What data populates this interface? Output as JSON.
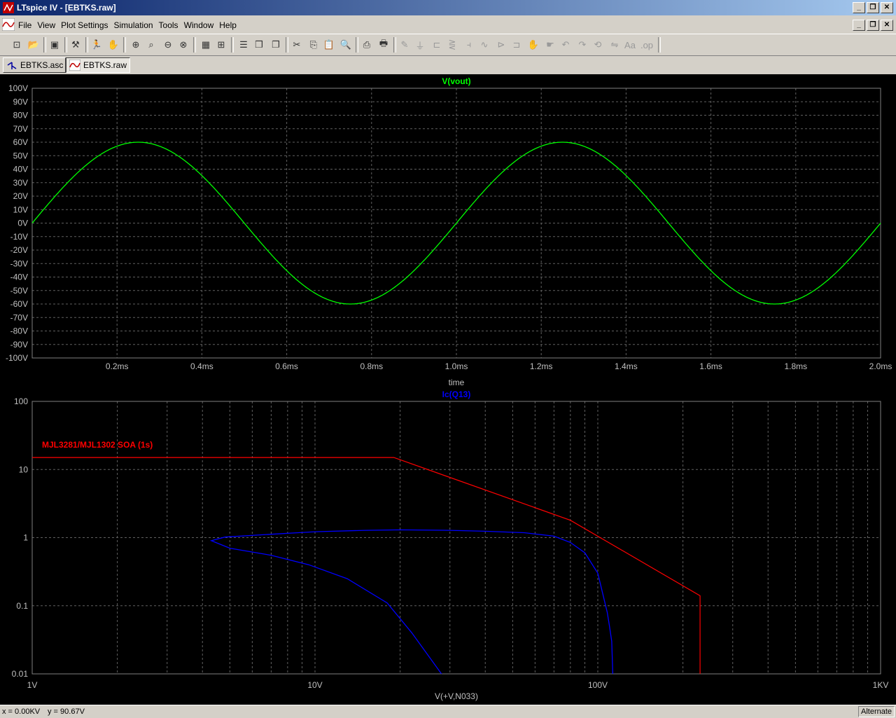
{
  "window": {
    "title": "LTspice IV - [EBTKS.raw]"
  },
  "menu": [
    "File",
    "View",
    "Plot Settings",
    "Simulation",
    "Tools",
    "Window",
    "Help"
  ],
  "tabs": [
    {
      "label": "EBTKS.asc",
      "icon": "schematic-icon"
    },
    {
      "label": "EBTKS.raw",
      "icon": "waveform-icon"
    }
  ],
  "top_plot": {
    "trace_label": "V(vout)",
    "trace_color": "#00ff00",
    "x_axis_label": "time",
    "x_ticks": [
      "0.2ms",
      "0.4ms",
      "0.6ms",
      "0.8ms",
      "1.0ms",
      "1.2ms",
      "1.4ms",
      "1.6ms",
      "1.8ms",
      "2.0ms"
    ],
    "y_ticks": [
      "100V",
      "90V",
      "80V",
      "70V",
      "60V",
      "50V",
      "40V",
      "30V",
      "20V",
      "10V",
      "0V",
      "-10V",
      "-20V",
      "-30V",
      "-40V",
      "-50V",
      "-60V",
      "-70V",
      "-80V",
      "-90V",
      "-100V"
    ]
  },
  "bottom_plot": {
    "trace_label": "Ic(Q13)",
    "trace_color": "#0000ff",
    "annotation": "MJL3281/MJL1302 SOA (1s)",
    "annotation_color": "#ff0000",
    "x_axis_label": "V(+V,N033)",
    "x_ticks": [
      "1V",
      "10V",
      "100V",
      "1KV"
    ],
    "y_ticks": [
      "100",
      "10",
      "1",
      "0.1",
      "0.01"
    ]
  },
  "status": {
    "x": "x = 0.00KV",
    "y": "y = 90.67V",
    "mode": "Alternate"
  },
  "chart_data": [
    {
      "type": "line",
      "title": "V(vout)",
      "xlabel": "time",
      "ylabel": "",
      "xlim_ms": [
        0,
        2.0
      ],
      "ylim": [
        -100,
        100
      ],
      "grid": true,
      "series": [
        {
          "name": "V(vout)",
          "color": "#00ff00",
          "x_ms": [
            0,
            0.125,
            0.25,
            0.375,
            0.5,
            0.625,
            0.75,
            0.875,
            1.0,
            1.125,
            1.25,
            1.375,
            1.5,
            1.625,
            1.75,
            1.875,
            2.0
          ],
          "y": [
            0,
            42.4,
            60,
            42.4,
            0,
            -42.4,
            -60,
            -42.4,
            0,
            42.4,
            60,
            42.4,
            0,
            -42.4,
            -60,
            -42.4,
            0
          ]
        }
      ]
    },
    {
      "type": "line",
      "title": "Ic(Q13)",
      "xlabel": "V(+V,N033)",
      "xscale": "log",
      "yscale": "log",
      "xlim": [
        1,
        1000
      ],
      "ylim": [
        0.01,
        100
      ],
      "grid": true,
      "series": [
        {
          "name": "MJL3281/MJL1302 SOA (1s)",
          "color": "#ff0000",
          "x": [
            1,
            19,
            80,
            230,
            230
          ],
          "y": [
            15,
            15,
            1.8,
            0.14,
            0.01
          ]
        },
        {
          "name": "Ic(Q13)",
          "color": "#0000ff",
          "x": [
            28,
            22,
            18,
            13,
            9.5,
            7,
            5,
            4.3,
            4.8,
            7,
            10,
            15,
            20,
            30,
            40,
            55,
            70,
            80,
            90,
            100,
            108,
            110,
            112,
            113
          ],
          "y": [
            0.01,
            0.04,
            0.11,
            0.25,
            0.4,
            0.55,
            0.7,
            0.9,
            1.02,
            1.12,
            1.22,
            1.28,
            1.3,
            1.28,
            1.24,
            1.18,
            1.05,
            0.85,
            0.6,
            0.3,
            0.08,
            0.05,
            0.03,
            0.01
          ]
        }
      ]
    }
  ]
}
